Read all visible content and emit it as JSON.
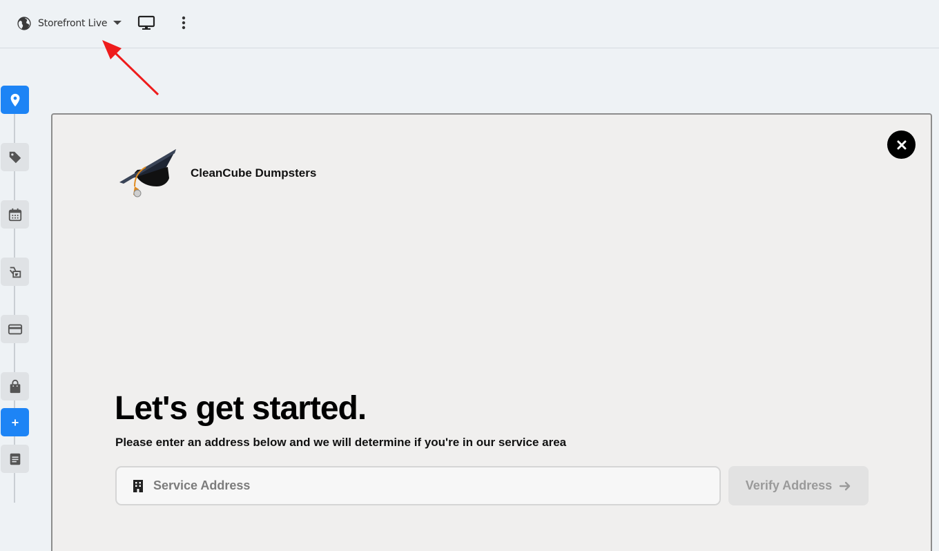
{
  "topbar": {
    "environment_label": "Storefront Live",
    "icons": {
      "environment": "globe-icon",
      "dropdown": "caret-down-icon",
      "preview": "monitor-icon",
      "more": "more-vertical-icon"
    }
  },
  "sidebar": {
    "items": [
      {
        "icon": "map-pin-icon",
        "active": true
      },
      {
        "icon": "tag-icon",
        "active": false
      },
      {
        "icon": "calendar-icon",
        "active": false
      },
      {
        "icon": "delivery-icon",
        "active": false
      },
      {
        "icon": "credit-card-icon",
        "active": false
      },
      {
        "icon": "shopping-bag-icon",
        "active": false
      },
      {
        "icon": "plus-icon",
        "active": true,
        "label": "+"
      },
      {
        "icon": "document-icon",
        "active": false
      }
    ]
  },
  "preview": {
    "brand_name": "CleanCube Dumpsters",
    "logo_icon": "graduation-cap-icon",
    "title": "Let's get started.",
    "subtitle": "Please enter an address below and we will determine if you're in our service area",
    "address_input": {
      "placeholder": "Service Address",
      "value": "",
      "icon": "building-icon"
    },
    "verify_button": {
      "label": "Verify Address",
      "icon": "arrow-right-icon"
    },
    "close_icon": "close-icon"
  },
  "colors": {
    "accent": "#1d84f5",
    "annotation": "#ee1c1c",
    "page_bg": "#eef2f5",
    "panel_bg": "#f0efee"
  }
}
